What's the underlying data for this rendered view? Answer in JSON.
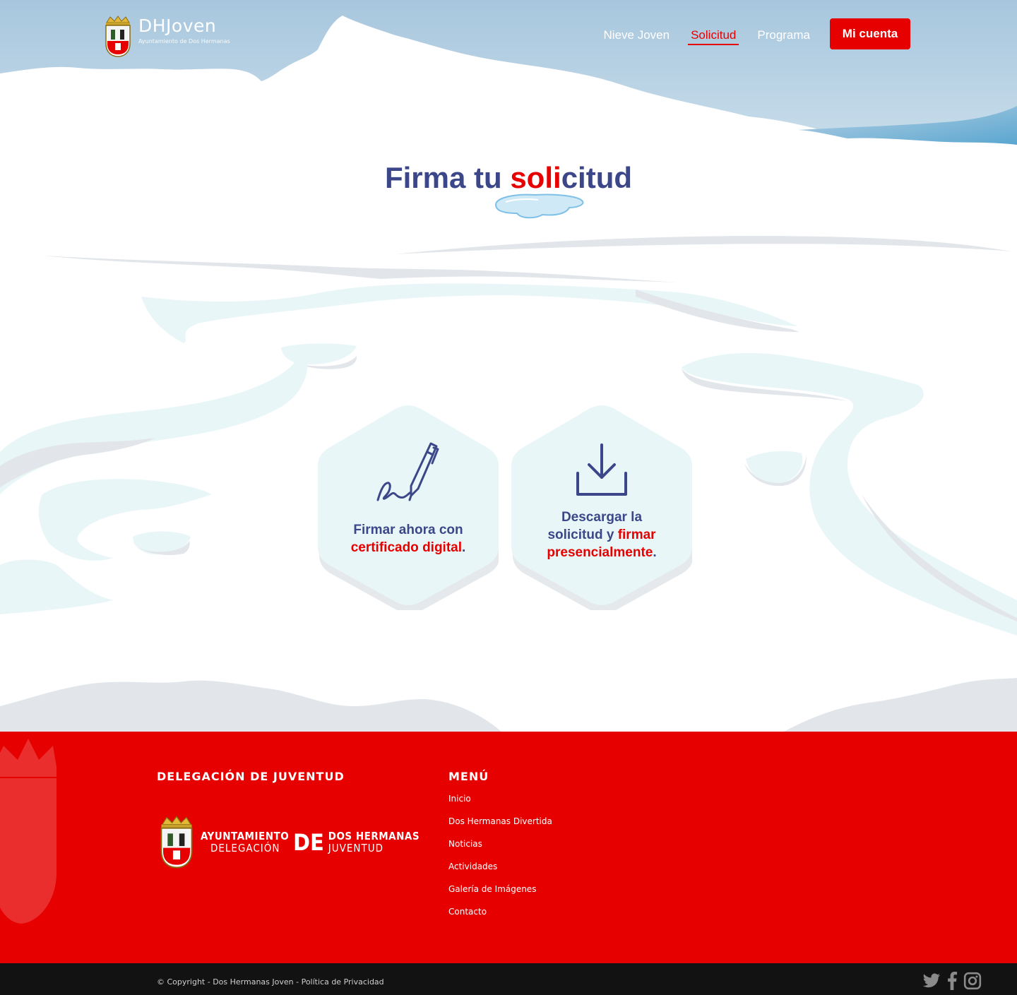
{
  "header": {
    "brand_name": "DHJoven",
    "brand_subtitle": "Ayuntamiento de Dos Hermanas",
    "nav": [
      {
        "label": "Nieve Joven",
        "active": false
      },
      {
        "label": "Solicitud",
        "active": true
      },
      {
        "label": "Programa",
        "active": false
      }
    ],
    "account_button": "Mi cuenta"
  },
  "main": {
    "title_pre": "Firma tu ",
    "title_highlight": "soli",
    "title_post": "citud",
    "options": [
      {
        "icon": "pen-signature-icon",
        "text_lead": "Firmar ahora con",
        "text_red": "certificado digital",
        "text_end": "."
      },
      {
        "icon": "download-icon",
        "text_lead": "Descargar la solicitud y",
        "text_red": "firmar presencialmente",
        "text_end": "."
      }
    ]
  },
  "footer": {
    "col1_heading": "DELEGACIÓN DE JUVENTUD",
    "logo": {
      "line1": "AYUNTAMIENTO",
      "line2": "DELEGACIÓN",
      "de": "DE",
      "line3": "DOS HERMANAS",
      "line4": "JUVENTUD"
    },
    "col2_heading": "MENÚ",
    "menu": [
      "Inicio",
      "Dos Hermanas Divertida",
      "Noticias",
      "Actividades",
      "Galería de Imágenes",
      "Contacto"
    ],
    "copyright": "© Copyright - Dos Hermanas Joven - Política de Privacidad",
    "social": [
      "twitter-icon",
      "facebook-icon",
      "instagram-icon"
    ]
  },
  "colors": {
    "brand_red": "#e60000",
    "navy": "#3c4789",
    "sky": "#a9c9e0",
    "ice": "#e8f6f8"
  }
}
